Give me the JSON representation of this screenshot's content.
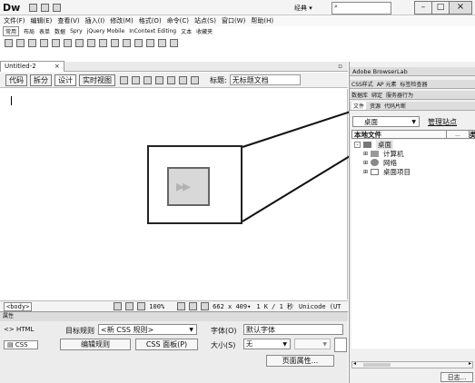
{
  "app": {
    "logo": "Dw",
    "workspace": "经典 ▾"
  },
  "window_controls": {
    "minimize": "–",
    "restore": "□",
    "close": "×"
  },
  "menu": [
    "文件(F)",
    "编辑(E)",
    "查看(V)",
    "插入(I)",
    "修改(M)",
    "格式(O)",
    "命令(C)",
    "站点(S)",
    "窗口(W)",
    "帮助(H)"
  ],
  "insert_tabs": [
    "常用",
    "布局",
    "表单",
    "数据",
    "Spry",
    "jQuery Mobile",
    "InContext Editing",
    "文本",
    "收藏夹"
  ],
  "document": {
    "tab": "Untitled-2",
    "tab_close": "×",
    "view_buttons": [
      "代码",
      "拆分",
      "设计",
      "实时视图"
    ],
    "title_label": "标题:",
    "title_value": "无标题文档"
  },
  "status_bar": {
    "tag": "<body>",
    "zoom": "100%",
    "size": "662 x 409▾",
    "file": "1 K / 1 秒",
    "encoding": "Unicode (UT"
  },
  "properties": {
    "panel_title": "属性",
    "html_tab": "<> HTML",
    "css_tab": "CSS",
    "target_rule_label": "目标规则",
    "target_rule_value": "<新 CSS 规则>",
    "edit_rule": "编辑规则",
    "css_panel": "CSS 面板(P)",
    "font_label": "字体(O)",
    "font_value": "默认字体",
    "size_label": "大小(S)",
    "size_value": "无",
    "page_props": "页面属性..."
  },
  "right_panels": {
    "browserlab": "Adobe BrowserLab",
    "css_tabs": [
      "CSS样式",
      "AP 元素",
      "标签检查器"
    ],
    "data_tabs": [
      "数据库",
      "绑定",
      "服务器行为"
    ],
    "file_tabs": [
      "文件",
      "资源",
      "代码片断"
    ],
    "site_select": "桌面",
    "manage_sites": "管理站点",
    "local_files": "本地文件",
    "col_type": "类",
    "tree": [
      {
        "label": "桌面",
        "level": 0
      },
      {
        "label": "计算机",
        "level": 1
      },
      {
        "label": "网络",
        "level": 1
      },
      {
        "label": "桌面项目",
        "level": 1
      }
    ],
    "log_button": "日志..."
  },
  "callout": {
    "glyph": "▸▸"
  }
}
